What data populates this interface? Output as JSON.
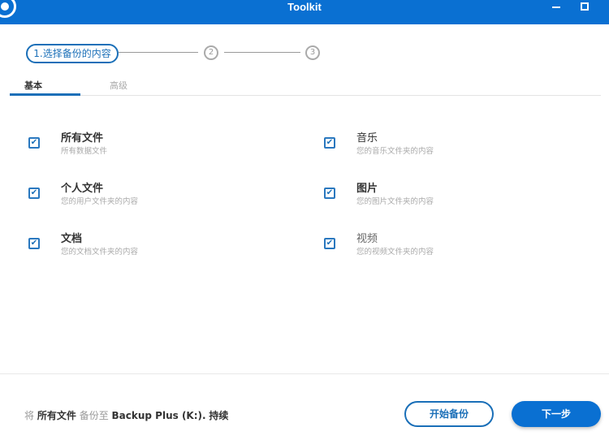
{
  "window": {
    "title": "Toolkit"
  },
  "steps": {
    "step1": "1.选择备份的内容",
    "step2": "2",
    "step3": "3"
  },
  "tabs": [
    {
      "label": "基本",
      "active": true
    },
    {
      "label": "高级",
      "active": false
    }
  ],
  "items": [
    {
      "title": "所有文件",
      "subtitle": "所有数据文件",
      "checked": true
    },
    {
      "title": "个人文件",
      "subtitle": "您的用户文件夹的内容",
      "checked": true
    },
    {
      "title": "文档",
      "subtitle": "您的文档文件夹的内容",
      "checked": true
    },
    {
      "title": "音乐",
      "subtitle": "您的音乐文件夹的内容",
      "checked": true
    },
    {
      "title": "图片",
      "subtitle": "您的图片文件夹的内容",
      "checked": true
    },
    {
      "title": "视频",
      "subtitle": "您的视频文件夹的内容",
      "checked": true
    }
  ],
  "footer": {
    "p1": "将",
    "p2": "所有文件",
    "p3": "备份至",
    "p4": "Backup Plus (K:).",
    "p5": "持续",
    "start_label": "开始备份",
    "next_label": "下一步"
  },
  "colors": {
    "accent": "#0a70d2"
  }
}
